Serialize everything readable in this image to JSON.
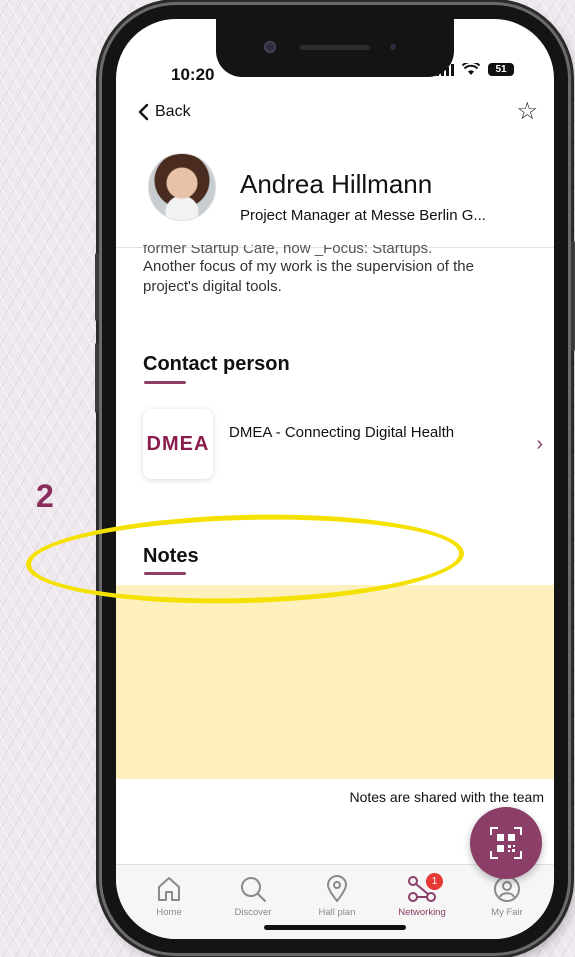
{
  "status": {
    "time": "10:20",
    "battery": "51"
  },
  "nav": {
    "back_label": "Back"
  },
  "profile": {
    "name": "Andrea Hillmann",
    "title": "Project Manager at Messe Berlin G..."
  },
  "bio": {
    "clipped_line": "former Startup Cafe, now _Focus: Startups.",
    "text": "Another focus of my work is the supervision of the project's digital tools."
  },
  "contact_section": {
    "title": "Contact person",
    "item": {
      "logo_text": "DMEA",
      "name": "DMEA - Connecting Digital Health",
      "chevron": "›"
    }
  },
  "notes_section": {
    "title": "Notes",
    "hint": "Notes are shared with the team"
  },
  "tabbar": {
    "items": [
      {
        "label": "Home",
        "icon": "home-icon"
      },
      {
        "label": "Discover",
        "icon": "search-icon"
      },
      {
        "label": "Hall plan",
        "icon": "location-pin-icon"
      },
      {
        "label": "Networking",
        "icon": "network-icon",
        "badge": "1",
        "active": true
      },
      {
        "label": "My Fair",
        "icon": "user-icon"
      }
    ]
  },
  "annotation": {
    "number": "2"
  },
  "colors": {
    "accent": "#8a3e68",
    "notes_bg": "#fdf0bd",
    "highlight": "#f5e100",
    "badge": "#e53935"
  }
}
